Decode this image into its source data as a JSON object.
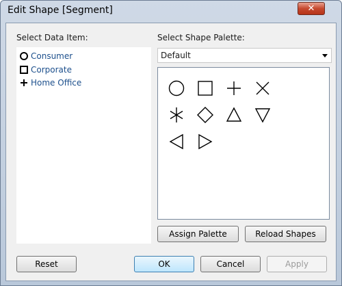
{
  "window": {
    "title": "Edit Shape [Segment]",
    "close_glyph": "✕"
  },
  "data_items": {
    "label": "Select Data Item:",
    "items": [
      {
        "label": "Consumer",
        "shape": "circle-icon"
      },
      {
        "label": "Corporate",
        "shape": "square-icon"
      },
      {
        "label": "Home Office",
        "shape": "plus-icon"
      }
    ]
  },
  "palette": {
    "label": "Select Shape Palette:",
    "selected": "Default",
    "shapes": [
      "circle",
      "square",
      "plus",
      "x",
      "asterisk",
      "diamond",
      "triangle-up",
      "triangle-down",
      "triangle-left",
      "triangle-right"
    ]
  },
  "buttons": {
    "assign_palette": "Assign Palette",
    "reload_shapes": "Reload Shapes",
    "reset": "Reset",
    "ok": "OK",
    "cancel": "Cancel",
    "apply": "Apply"
  }
}
